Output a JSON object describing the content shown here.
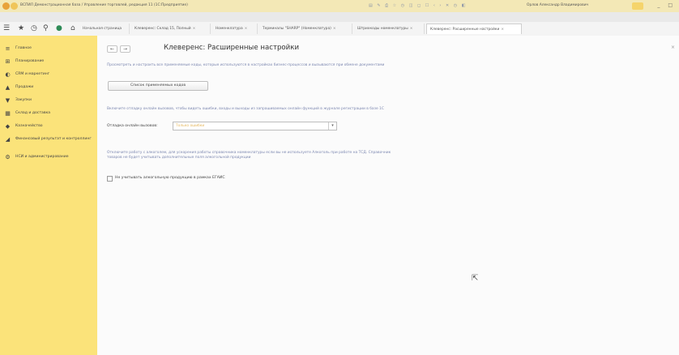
{
  "window": {
    "title": "ВСПИЛ Демонстрационная база / Управление торговлей, редакция 11 (1С:Предприятие)",
    "user": "Орлов Александр Владимирович",
    "toolbar_icons": "▤ ✎ ⎙ ☆ ◷ ◫ ◻ ☐ ‹ › ✕ ◷ ◧"
  },
  "nav_icons": {
    "menu": "☰",
    "favorites": "★",
    "history": "◷",
    "search": "⚲",
    "stop": "●",
    "home": "⌂"
  },
  "tabs": [
    {
      "label": "Начальная страница",
      "closable": false
    },
    {
      "label": "Клеверенс: Склад 15, Полный",
      "closable": true
    },
    {
      "label": "Номенклатура",
      "closable": true
    },
    {
      "label": "Терминалы \"SHARP\" (Номенклатура)",
      "closable": true
    },
    {
      "label": "Штрихкоды номенклатуры",
      "closable": true
    },
    {
      "label": "Клеверенс: Расширенные настройки",
      "closable": true,
      "active": true
    }
  ],
  "sidebar": {
    "items": [
      {
        "label": "Главное",
        "icon": "≡"
      },
      {
        "label": "Планирование",
        "icon": "⊞"
      },
      {
        "label": "CRM и маркетинг",
        "icon": "◐"
      },
      {
        "label": "Продажи",
        "icon": "▲"
      },
      {
        "label": "Закупки",
        "icon": "▼"
      },
      {
        "label": "Склад и доставка",
        "icon": "▦"
      },
      {
        "label": "Казначейство",
        "icon": "◆"
      },
      {
        "label": "Финансовый результат и контроллинг",
        "icon": "◢"
      },
      {
        "label": "НСИ и администрирование",
        "icon": "⚙"
      }
    ]
  },
  "content": {
    "back": "←",
    "forward": "→",
    "title": "Клеверенс: Расширенные настройки",
    "close": "×",
    "para1": "Просмотреть и настроить все применяемые коды, которые используются в настройках бизнес-процессов и вызываются при обмене документами",
    "codes_button": "Список применяемых кодов",
    "para2": "Включите отладку онлайн вызовов, чтобы видеть ошибки, входы и выходы из запрашиваемых онлайн функций в журнале регистрации в базе 1С",
    "debug_label": "Отладка онлайн вызовов:",
    "debug_value": "Только ошибки",
    "para3": "Отключите работу с алкоголем, для ускорения работы справочника номенклатуры если вы не используете Алкоголь при работе на ТСД. Справочник товаров не будет учитывать дополнительные поля алкогольной продукции",
    "alc_label": "Не учитывать алкогольную продукцию в рамках ЕГАИС",
    "alc_checked": false
  }
}
